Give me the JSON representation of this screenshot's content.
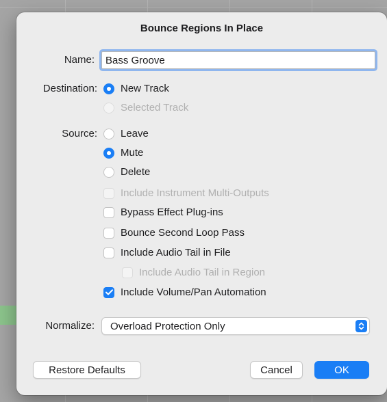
{
  "dialog": {
    "title": "Bounce Regions In Place",
    "name_label": "Name:",
    "name_value": "Bass Groove",
    "destination_label": "Destination:",
    "destination_options": [
      {
        "label": "New Track",
        "selected": true,
        "enabled": true
      },
      {
        "label": "Selected Track",
        "selected": false,
        "enabled": false
      }
    ],
    "source_label": "Source:",
    "source_options": [
      {
        "label": "Leave",
        "selected": false,
        "enabled": true
      },
      {
        "label": "Mute",
        "selected": true,
        "enabled": true
      },
      {
        "label": "Delete",
        "selected": false,
        "enabled": true
      }
    ],
    "checkboxes": [
      {
        "label": "Include Instrument Multi-Outputs",
        "checked": false,
        "enabled": false
      },
      {
        "label": "Bypass Effect Plug-ins",
        "checked": false,
        "enabled": true
      },
      {
        "label": "Bounce Second Loop Pass",
        "checked": false,
        "enabled": true
      },
      {
        "label": "Include Audio Tail in File",
        "checked": false,
        "enabled": true
      },
      {
        "label": "Include Audio Tail in Region",
        "checked": false,
        "enabled": false
      },
      {
        "label": "Include Volume/Pan Automation",
        "checked": true,
        "enabled": true
      }
    ],
    "normalize_label": "Normalize:",
    "normalize_value": "Overload Protection Only",
    "restore_defaults_label": "Restore Defaults",
    "cancel_label": "Cancel",
    "ok_label": "OK"
  },
  "colors": {
    "accent": "#1a7ef5",
    "dialog_bg": "#ececec",
    "disabled_text": "#b0b0b0"
  }
}
